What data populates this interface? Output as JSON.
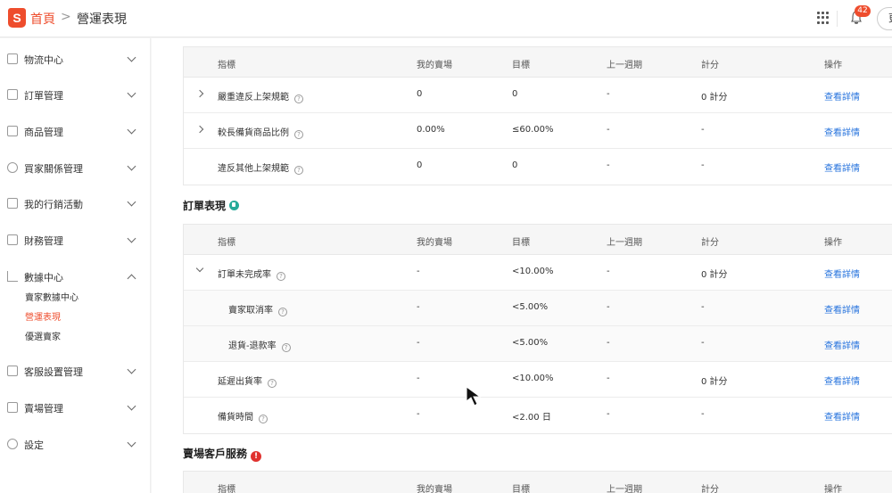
{
  "header": {
    "logo_letter": "S",
    "breadcrumb_home": "首頁",
    "breadcrumb_sep": ">",
    "breadcrumb_current": "營運表現",
    "notification_count": "42",
    "top_button": "更"
  },
  "sidebar": {
    "items": [
      {
        "label": "物流中心"
      },
      {
        "label": "訂單管理"
      },
      {
        "label": "商品管理"
      },
      {
        "label": "買家關係管理"
      },
      {
        "label": "我的行銷活動"
      },
      {
        "label": "財務管理"
      },
      {
        "label": "數據中心"
      },
      {
        "label": "客服設置管理"
      },
      {
        "label": "賣場管理"
      },
      {
        "label": "設定"
      }
    ],
    "data_center_sub": [
      {
        "label": "賣家數據中心"
      },
      {
        "label": "營運表現"
      },
      {
        "label": "優選賣家"
      }
    ]
  },
  "columns": [
    "指標",
    "我的賣場",
    "目標",
    "上一週期",
    "計分",
    "操作"
  ],
  "listing_table": {
    "rows": [
      {
        "name": "嚴重違反上架規範",
        "mine": "0",
        "target": "0",
        "last": "-",
        "score": "0 計分",
        "op": "查看詳情"
      },
      {
        "name": "較長備貨商品比例",
        "mine": "0.00%",
        "target": "≤60.00%",
        "last": "-",
        "score": "-",
        "op": "查看詳情"
      },
      {
        "name": "違反其他上架規範",
        "mine": "0",
        "target": "0",
        "last": "-",
        "score": "-",
        "op": "查看詳情"
      }
    ]
  },
  "order_section": {
    "title": "訂單表現",
    "rows": [
      {
        "name": "訂單未完成率",
        "mine": "-",
        "target": "<10.00%",
        "last": "-",
        "score": "0 計分",
        "op": "查看詳情"
      },
      {
        "name": "賣家取消率",
        "mine": "-",
        "target": "<5.00%",
        "last": "-",
        "score": "-",
        "op": "查看詳情"
      },
      {
        "name": "退貨-退款率",
        "mine": "-",
        "target": "<5.00%",
        "last": "-",
        "score": "-",
        "op": "查看詳情"
      },
      {
        "name": "延遲出貨率",
        "mine": "-",
        "target": "<10.00%",
        "last": "-",
        "score": "0 計分",
        "op": "查看詳情"
      },
      {
        "name": "備貨時間",
        "mine": "-",
        "target": "<2.00 日",
        "last": "-",
        "score": "-",
        "op": "查看詳情"
      }
    ]
  },
  "service_section": {
    "title": "賣場客戶服務"
  },
  "icons": {
    "help": "?",
    "warn": "!"
  },
  "colors": {
    "brand": "#ee4d2d",
    "link": "#2673dd",
    "ok": "#26aa99",
    "warn": "#e0322f"
  }
}
